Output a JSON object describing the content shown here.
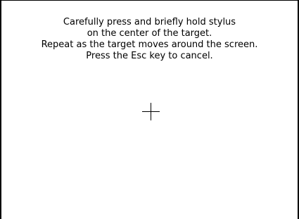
{
  "calibration": {
    "instructions": [
      "Carefully press and briefly hold stylus",
      "on the center of the target.",
      "Repeat as the target moves around the screen.",
      "Press the Esc key to cancel."
    ],
    "target_icon": "crosshair-icon",
    "colors": {
      "background": "#ffffff",
      "foreground": "#000000"
    }
  }
}
